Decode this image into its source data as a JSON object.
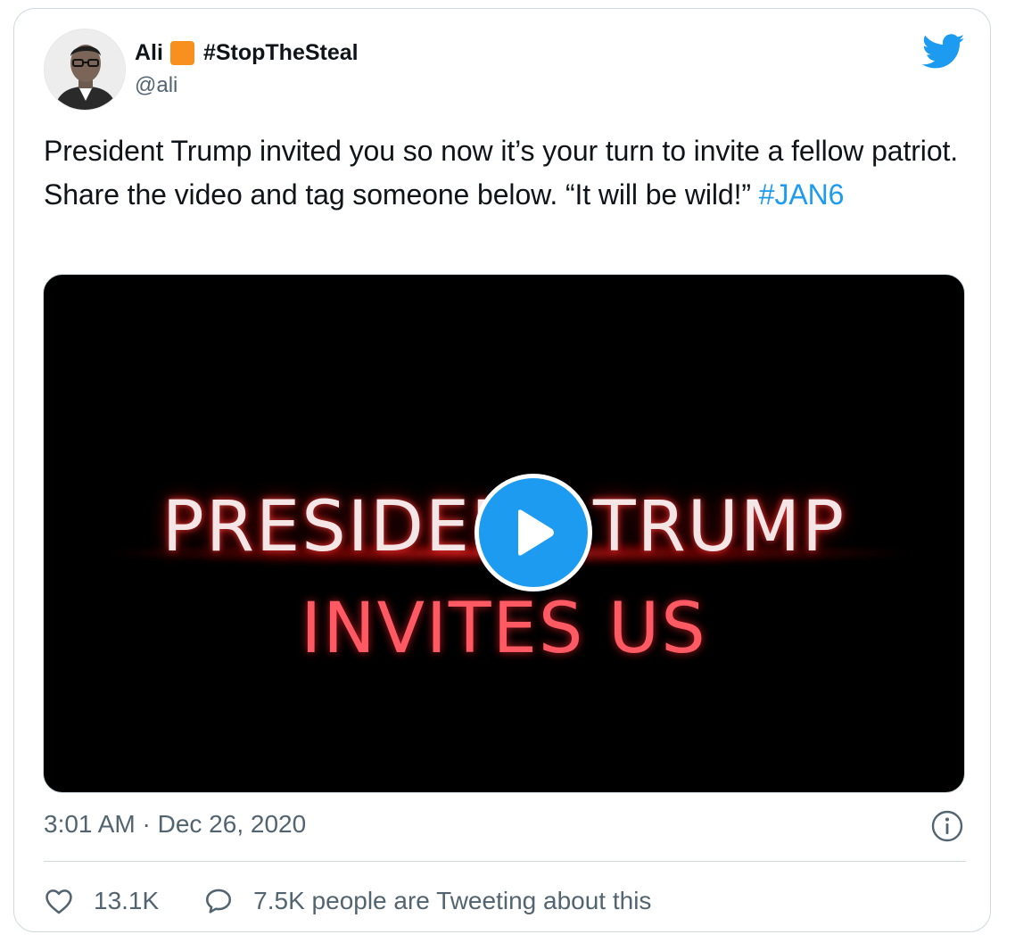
{
  "author": {
    "name": "Ali",
    "hashtag": "#StopTheSteal",
    "handle": "@ali"
  },
  "tweet": {
    "text": "President Trump invited you so now it’s your turn to invite a fellow patriot. Share the video and tag someone below. “It will be wild!” ",
    "hashtag": "#JAN6"
  },
  "media": {
    "line1": "PRESIDENT TRUMP",
    "line2": "INVITES US"
  },
  "meta": {
    "timestamp": "3:01 AM · Dec 26, 2020"
  },
  "actions": {
    "likes": "13.1K",
    "tweeting": "7.5K people are Tweeting about this"
  },
  "icons": {
    "brand": "twitter-bird-icon",
    "info": "info-icon",
    "like": "heart-icon",
    "reply": "speech-bubble-icon",
    "play": "play-icon"
  },
  "colors": {
    "accent": "#1d9bf0",
    "badge": "#f7901e",
    "secondary_text": "#536471"
  }
}
